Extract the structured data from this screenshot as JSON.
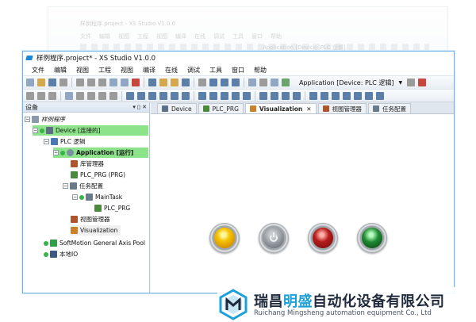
{
  "ghost": {
    "title": "样例程序.project - XS Studio V1.0.0",
    "menu": [
      "文件",
      "编辑",
      "视图",
      "工程",
      "视图",
      "编译",
      "在线",
      "调试",
      "工具",
      "窗口",
      "帮助"
    ],
    "app_label": "Application [Device: PLC 逻辑]"
  },
  "window": {
    "title": "样例程序.project* - XS Studio V1.0.0",
    "menu": [
      "文件",
      "编辑",
      "视图",
      "工程",
      "视图",
      "编译",
      "在线",
      "调试",
      "工具",
      "窗口",
      "帮助"
    ],
    "app_combo": "Application [Device: PLC 逻辑]"
  },
  "devices_pane": {
    "header": "设备",
    "pin_label": "▾ ▯ ✕",
    "root": "样例程序",
    "tree": [
      {
        "label": "Device [连接的]",
        "level": 1
      },
      {
        "label": "PLC 逻辑",
        "level": 2
      },
      {
        "label": "Application [运行]",
        "level": 3
      },
      {
        "label": "库管理器",
        "level": 4
      },
      {
        "label": "PLC_PRG (PRG)",
        "level": 4
      },
      {
        "label": "任务配置",
        "level": 4
      },
      {
        "label": "MainTask",
        "level": 5
      },
      {
        "label": "PLC_PRG",
        "level": 6
      },
      {
        "label": "视图管理器",
        "level": 4
      },
      {
        "label": "Visualization",
        "level": 4
      },
      {
        "label": "SoftMotion General Axis Pool",
        "level": 2
      },
      {
        "label": "本地IO",
        "level": 2
      }
    ]
  },
  "editor": {
    "tabs": [
      {
        "label": "Device",
        "active": false
      },
      {
        "label": "PLC_PRG",
        "active": false
      },
      {
        "label": "Visualization",
        "active": true
      },
      {
        "label": "视图管理器",
        "active": false
      },
      {
        "label": "任务配置",
        "active": false
      }
    ],
    "lamps": [
      "yellow-lamp",
      "power-button",
      "red-lamp",
      "green-lamp"
    ]
  },
  "brand": {
    "cn_prefix": "瑞昌",
    "cn_accent": "明盛",
    "cn_suffix": "自动化设备有限公司",
    "en": "Ruichang Mingsheng automation equipment Co., Ltd"
  },
  "colors": {
    "accent": "#1ba0d7",
    "selection_green": "#8de38a",
    "window_border": "#6fb3e8"
  }
}
